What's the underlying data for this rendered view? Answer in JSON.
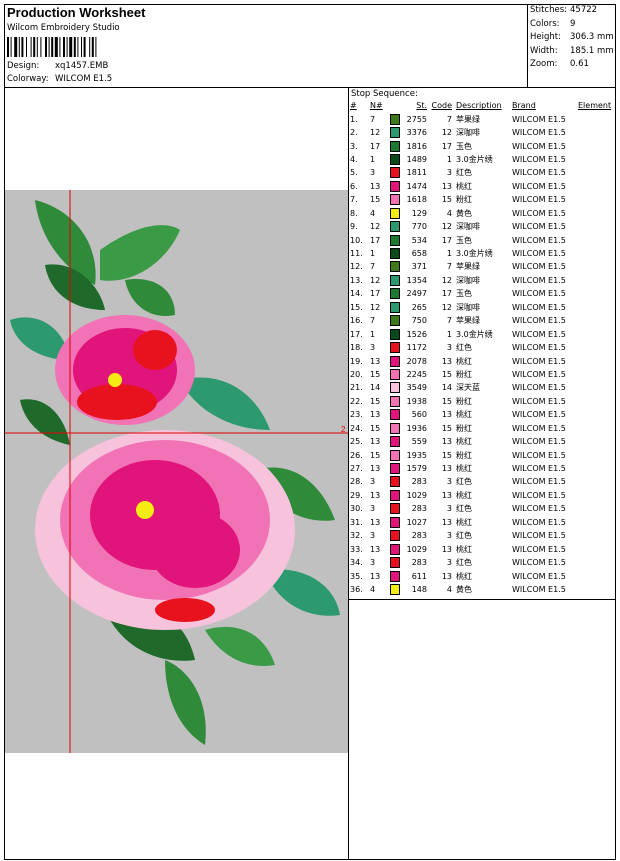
{
  "header": {
    "title": "Production Worksheet",
    "company": "Wilcom Embroidery Studio",
    "design_label": "Design:",
    "design_value": "xq1457.EMB",
    "colorway_label": "Colorway:",
    "colorway_value": "WILCOM E1.5"
  },
  "stats": [
    {
      "label": "Stitches:",
      "value": "45722"
    },
    {
      "label": "Colors:",
      "value": "9"
    },
    {
      "label": "Height:",
      "value": "306.3 mm"
    },
    {
      "label": "Width:",
      "value": "185.1 mm"
    },
    {
      "label": "Zoom:",
      "value": "0.61"
    }
  ],
  "stop_sequence": {
    "title": "Stop Sequence:",
    "headers": [
      "#",
      "N#",
      "St.",
      "Code",
      "Description",
      "Brand",
      "Element"
    ],
    "rows": [
      {
        "idx": "1.",
        "n": "7",
        "color": "#3f7a1a",
        "st": "2755",
        "code": "7",
        "desc": "苹果绿",
        "brand": "WILCOM E1.5"
      },
      {
        "idx": "2.",
        "n": "12",
        "color": "#2c9a6e",
        "st": "3376",
        "code": "12",
        "desc": "深咖啡",
        "brand": "WILCOM E1.5"
      },
      {
        "idx": "3.",
        "n": "17",
        "color": "#1e7a2e",
        "st": "1816",
        "code": "17",
        "desc": "玉色",
        "brand": "WILCOM E1.5"
      },
      {
        "idx": "4.",
        "n": "1",
        "color": "#0c4a1a",
        "st": "1489",
        "code": "1",
        "desc": "3.0金片绣",
        "brand": "WILCOM E1.5"
      },
      {
        "idx": "5.",
        "n": "3",
        "color": "#e8121e",
        "st": "1811",
        "code": "3",
        "desc": "红色",
        "brand": "WILCOM E1.5"
      },
      {
        "idx": "6.",
        "n": "13",
        "color": "#e0147a",
        "st": "1474",
        "code": "13",
        "desc": "桃红",
        "brand": "WILCOM E1.5"
      },
      {
        "idx": "7.",
        "n": "15",
        "color": "#f272b6",
        "st": "1618",
        "code": "15",
        "desc": "粉红",
        "brand": "WILCOM E1.5"
      },
      {
        "idx": "8.",
        "n": "4",
        "color": "#f4ec12",
        "st": "129",
        "code": "4",
        "desc": "黄色",
        "brand": "WILCOM E1.5"
      },
      {
        "idx": "9.",
        "n": "12",
        "color": "#2c9a6e",
        "st": "770",
        "code": "12",
        "desc": "深咖啡",
        "brand": "WILCOM E1.5"
      },
      {
        "idx": "10.",
        "n": "17",
        "color": "#1e7a2e",
        "st": "534",
        "code": "17",
        "desc": "玉色",
        "brand": "WILCOM E1.5"
      },
      {
        "idx": "11.",
        "n": "1",
        "color": "#0c4a1a",
        "st": "658",
        "code": "1",
        "desc": "3.0金片绣",
        "brand": "WILCOM E1.5"
      },
      {
        "idx": "12.",
        "n": "7",
        "color": "#3f7a1a",
        "st": "371",
        "code": "7",
        "desc": "苹果绿",
        "brand": "WILCOM E1.5"
      },
      {
        "idx": "13.",
        "n": "12",
        "color": "#2c9a6e",
        "st": "1354",
        "code": "12",
        "desc": "深咖啡",
        "brand": "WILCOM E1.5"
      },
      {
        "idx": "14.",
        "n": "17",
        "color": "#1e7a2e",
        "st": "2497",
        "code": "17",
        "desc": "玉色",
        "brand": "WILCOM E1.5"
      },
      {
        "idx": "15.",
        "n": "12",
        "color": "#2c9a6e",
        "st": "265",
        "code": "12",
        "desc": "深咖啡",
        "brand": "WILCOM E1.5"
      },
      {
        "idx": "16.",
        "n": "7",
        "color": "#3f7a1a",
        "st": "750",
        "code": "7",
        "desc": "苹果绿",
        "brand": "WILCOM E1.5"
      },
      {
        "idx": "17.",
        "n": "1",
        "color": "#0c4a1a",
        "st": "1526",
        "code": "1",
        "desc": "3.0金片绣",
        "brand": "WILCOM E1.5"
      },
      {
        "idx": "18.",
        "n": "3",
        "color": "#e8121e",
        "st": "1172",
        "code": "3",
        "desc": "红色",
        "brand": "WILCOM E1.5"
      },
      {
        "idx": "19.",
        "n": "13",
        "color": "#e0147a",
        "st": "2078",
        "code": "13",
        "desc": "桃红",
        "brand": "WILCOM E1.5"
      },
      {
        "idx": "20.",
        "n": "15",
        "color": "#f272b6",
        "st": "2245",
        "code": "15",
        "desc": "粉红",
        "brand": "WILCOM E1.5"
      },
      {
        "idx": "21.",
        "n": "14",
        "color": "#f6c2dc",
        "st": "3549",
        "code": "14",
        "desc": "深天蓝",
        "brand": "WILCOM E1.5"
      },
      {
        "idx": "22.",
        "n": "15",
        "color": "#f272b6",
        "st": "1938",
        "code": "15",
        "desc": "粉红",
        "brand": "WILCOM E1.5"
      },
      {
        "idx": "23.",
        "n": "13",
        "color": "#e0147a",
        "st": "560",
        "code": "13",
        "desc": "桃红",
        "brand": "WILCOM E1.5"
      },
      {
        "idx": "24.",
        "n": "15",
        "color": "#f272b6",
        "st": "1936",
        "code": "15",
        "desc": "粉红",
        "brand": "WILCOM E1.5"
      },
      {
        "idx": "25.",
        "n": "13",
        "color": "#e0147a",
        "st": "559",
        "code": "13",
        "desc": "桃红",
        "brand": "WILCOM E1.5"
      },
      {
        "idx": "26.",
        "n": "15",
        "color": "#f272b6",
        "st": "1935",
        "code": "15",
        "desc": "粉红",
        "brand": "WILCOM E1.5"
      },
      {
        "idx": "27.",
        "n": "13",
        "color": "#e0147a",
        "st": "1579",
        "code": "13",
        "desc": "桃红",
        "brand": "WILCOM E1.5"
      },
      {
        "idx": "28.",
        "n": "3",
        "color": "#e8121e",
        "st": "283",
        "code": "3",
        "desc": "红色",
        "brand": "WILCOM E1.5"
      },
      {
        "idx": "29.",
        "n": "13",
        "color": "#e0147a",
        "st": "1029",
        "code": "13",
        "desc": "桃红",
        "brand": "WILCOM E1.5"
      },
      {
        "idx": "30.",
        "n": "3",
        "color": "#e8121e",
        "st": "283",
        "code": "3",
        "desc": "红色",
        "brand": "WILCOM E1.5"
      },
      {
        "idx": "31.",
        "n": "13",
        "color": "#e0147a",
        "st": "1027",
        "code": "13",
        "desc": "桃红",
        "brand": "WILCOM E1.5"
      },
      {
        "idx": "32.",
        "n": "3",
        "color": "#e8121e",
        "st": "283",
        "code": "3",
        "desc": "红色",
        "brand": "WILCOM E1.5"
      },
      {
        "idx": "33.",
        "n": "13",
        "color": "#e0147a",
        "st": "1029",
        "code": "13",
        "desc": "桃红",
        "brand": "WILCOM E1.5"
      },
      {
        "idx": "34.",
        "n": "3",
        "color": "#e8121e",
        "st": "283",
        "code": "3",
        "desc": "红色",
        "brand": "WILCOM E1.5"
      },
      {
        "idx": "35.",
        "n": "13",
        "color": "#e0147a",
        "st": "611",
        "code": "13",
        "desc": "桃红",
        "brand": "WILCOM E1.5"
      },
      {
        "idx": "36.",
        "n": "4",
        "color": "#f4ec12",
        "st": "148",
        "code": "4",
        "desc": "黄色",
        "brand": "WILCOM E1.5"
      }
    ]
  },
  "preview": {
    "background": "#c0c0c0",
    "marker_color": "#e00000",
    "marker_label": "2"
  }
}
